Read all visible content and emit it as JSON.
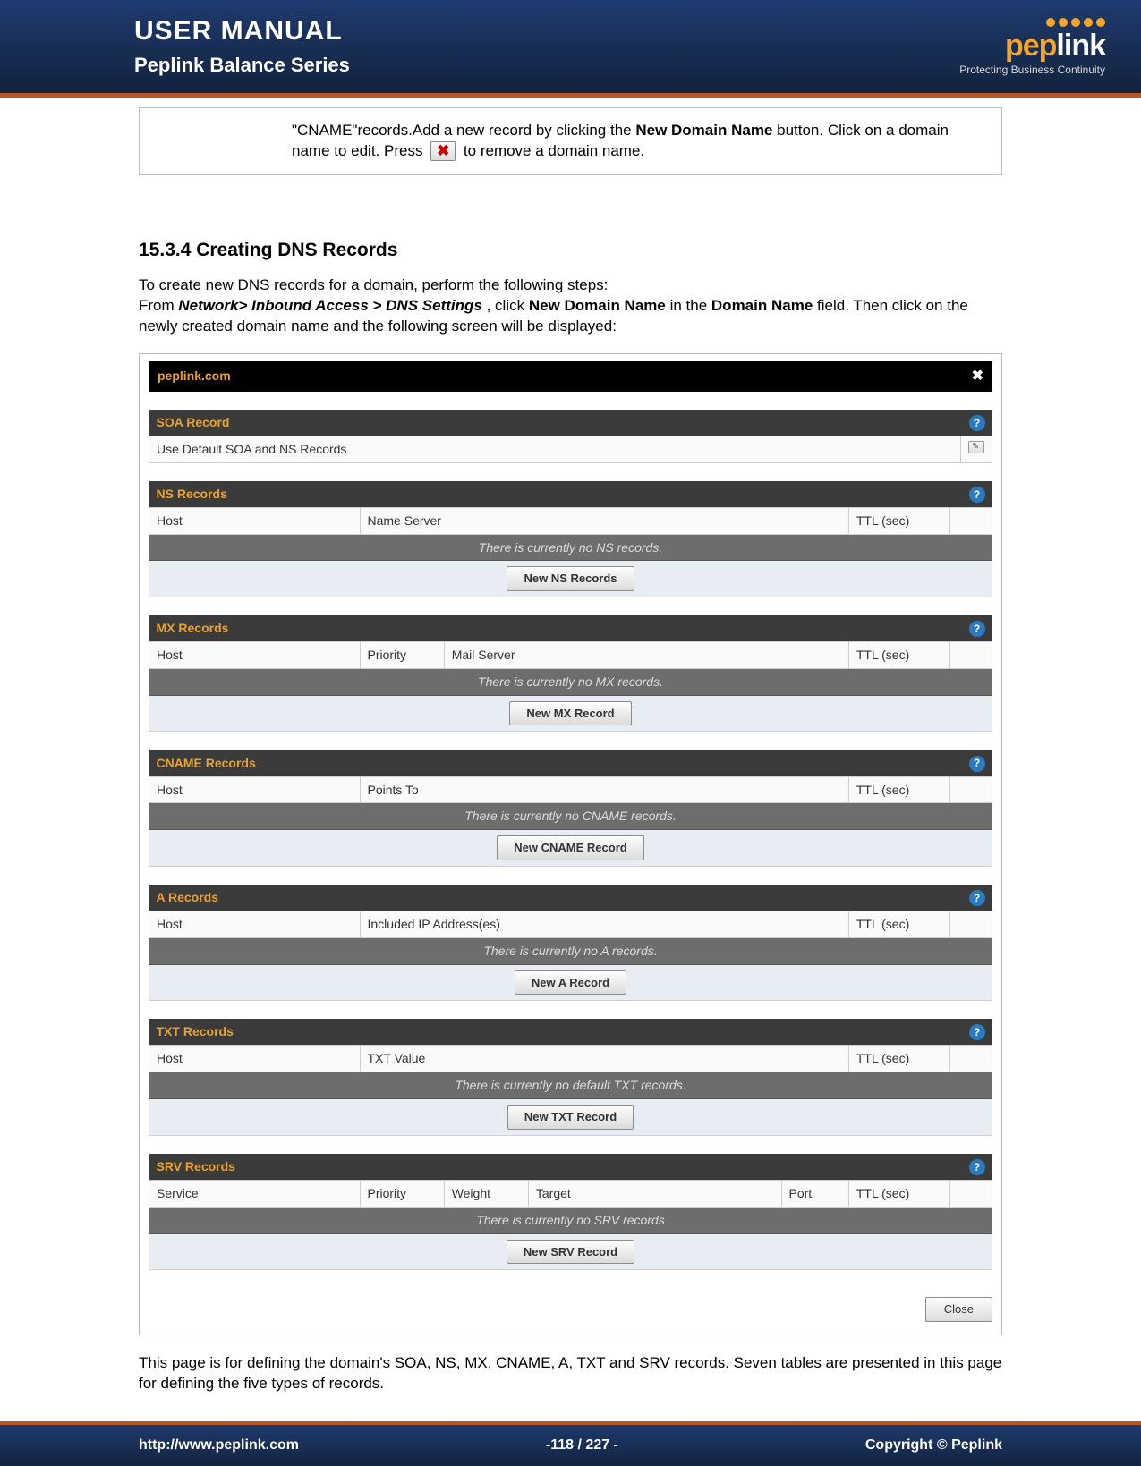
{
  "header": {
    "title": "USER MANUAL",
    "subtitle": "Peplink Balance Series",
    "logo_main": "peplink",
    "logo_tag": "Protecting Business Continuity"
  },
  "note": {
    "pre": "\"CNAME\"records.Add a new record by clicking the ",
    "bold1": "New Domain Name",
    "mid": " button. Click on a domain name to edit. Press ",
    "post": " to remove a domain name."
  },
  "section": {
    "heading": "15.3.4 Creating DNS Records",
    "p1": "To create new DNS records for a domain, perform the following steps:",
    "p2_pre": "From ",
    "p2_nav": "Network> Inbound Access > DNS Settings",
    "p2_mid1": ", click ",
    "p2_bold1": "New Domain Name",
    "p2_mid2": "in the ",
    "p2_bold2": "Domain Name",
    "p2_mid3": " field. Then click on the newly created domain name and the following screen will be displayed:"
  },
  "dns": {
    "domain": "peplink.com",
    "soa": {
      "title": "SOA Record",
      "row": "Use Default SOA and NS Records"
    },
    "ns": {
      "title": "NS Records",
      "cols": {
        "host": "Host",
        "server": "Name Server",
        "ttl": "TTL (sec)"
      },
      "empty": "There is currently no NS records.",
      "btn": "New NS Records"
    },
    "mx": {
      "title": "MX Records",
      "cols": {
        "host": "Host",
        "priority": "Priority",
        "server": "Mail Server",
        "ttl": "TTL (sec)"
      },
      "empty": "There is currently no MX records.",
      "btn": "New MX Record"
    },
    "cname": {
      "title": "CNAME Records",
      "cols": {
        "host": "Host",
        "points": "Points To",
        "ttl": "TTL (sec)"
      },
      "empty": "There is currently no CNAME records.",
      "btn": "New CNAME Record"
    },
    "a": {
      "title": "A Records",
      "cols": {
        "host": "Host",
        "ip": "Included IP Address(es)",
        "ttl": "TTL (sec)"
      },
      "empty": "There is currently no A records.",
      "btn": "New A Record"
    },
    "txt": {
      "title": "TXT Records",
      "cols": {
        "host": "Host",
        "val": "TXT Value",
        "ttl": "TTL (sec)"
      },
      "empty": "There is currently no default TXT records.",
      "btn": "New TXT Record"
    },
    "srv": {
      "title": "SRV Records",
      "cols": {
        "service": "Service",
        "priority": "Priority",
        "weight": "Weight",
        "target": "Target",
        "port": "Port",
        "ttl": "TTL (sec)"
      },
      "empty": "There is currently no SRV records",
      "btn": "New SRV Record"
    },
    "close": "Close"
  },
  "outro": "This page is for defining the domain's SOA, NS, MX, CNAME, A, TXT and SRV records. Seven tables are presented in this page for defining the five types of records.",
  "footer": {
    "url": "http://www.peplink.com",
    "page": "-118 / 227 -",
    "copyright": "Copyright ©  Peplink"
  }
}
